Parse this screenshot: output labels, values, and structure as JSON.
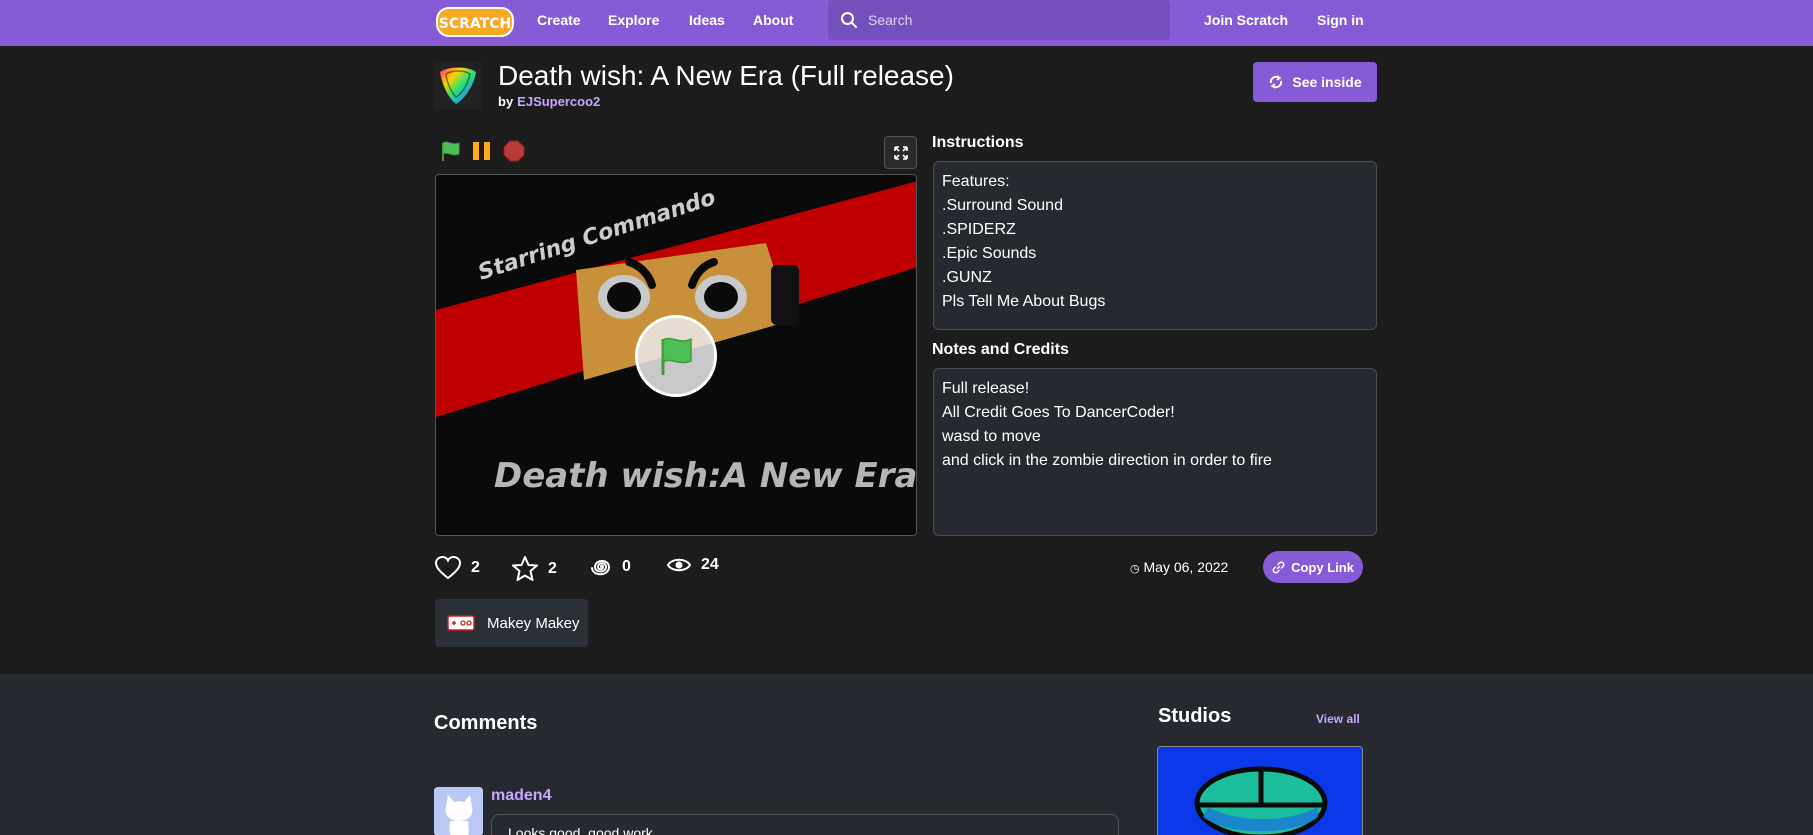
{
  "nav": {
    "logo_text": "SCRATCH",
    "links": [
      "Create",
      "Explore",
      "Ideas",
      "About"
    ],
    "search_placeholder": "Search",
    "join": "Join Scratch",
    "signin": "Sign in"
  },
  "project": {
    "title": "Death wish: A New Era (Full release)",
    "by_label": "by",
    "author": "EJSupercoo2",
    "see_inside": "See inside"
  },
  "stage": {
    "banner_text": "Starring Commando",
    "title_text": "Death wish:A New Era"
  },
  "instructions": {
    "heading": "Instructions",
    "lines": [
      "Features:",
      ".Surround Sound",
      ".SPIDERZ",
      ".Epic Sounds",
      ".GUNZ",
      "Pls Tell Me About Bugs"
    ]
  },
  "notes": {
    "heading": "Notes and Credits",
    "lines": [
      "Full release!",
      "All Credit Goes To DancerCoder!",
      "wasd to move",
      "and click in the zombie direction in order to fire"
    ]
  },
  "stats": {
    "loves": "2",
    "favorites": "2",
    "remixes": "0",
    "views": "24"
  },
  "date": "May 06, 2022",
  "copy_link": "Copy Link",
  "extension": "Makey Makey",
  "comments": {
    "heading": "Comments",
    "first_user": "maden4",
    "first_text": "Looks good, good work"
  },
  "studios": {
    "heading": "Studios",
    "view_all": "View all"
  },
  "colors": {
    "nav": "#855cd6",
    "accent": "#855cd6",
    "link": "#c6a8ff",
    "page_bg": "#1c1c1c",
    "panel_bg": "#262a30"
  }
}
